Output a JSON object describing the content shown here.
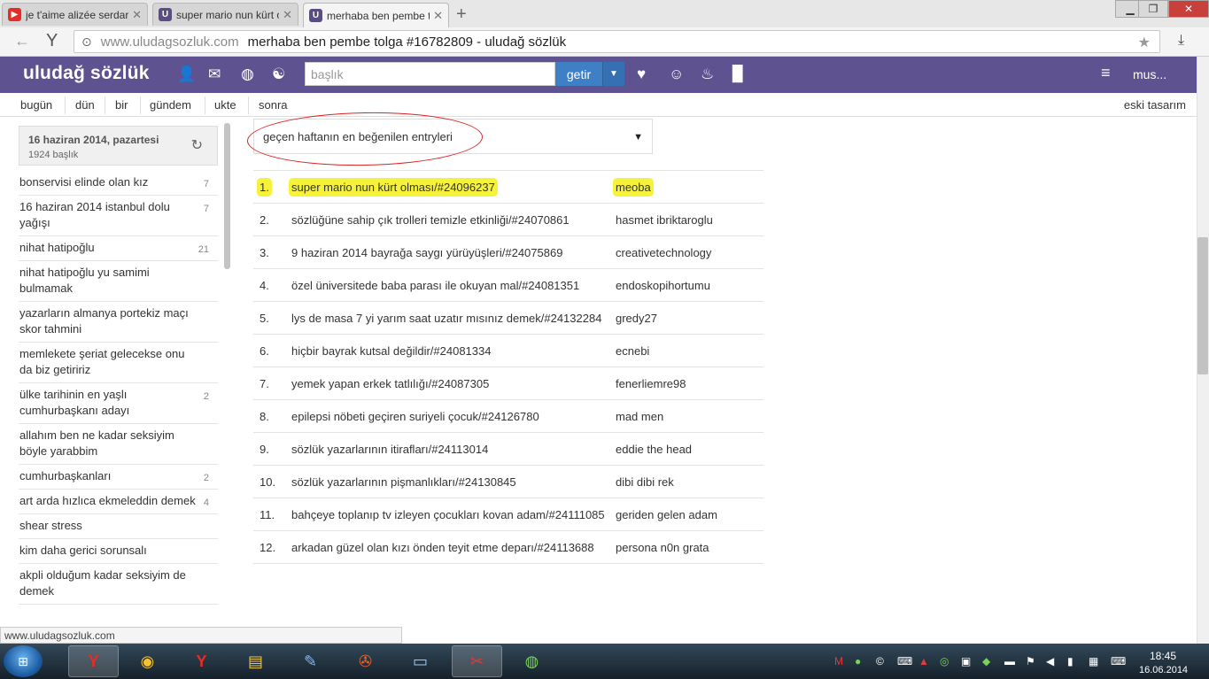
{
  "browser": {
    "tabs": [
      {
        "title": "je t'aime alizée serdar o",
        "favicon": "youtube-icon",
        "active": false
      },
      {
        "title": "super mario nun kürt o",
        "favicon": "uludag-icon",
        "active": false
      },
      {
        "title": "merhaba ben pembe t",
        "favicon": "uludag-icon",
        "active": true
      }
    ],
    "url_domain": "www.uludagsozluk.com",
    "url_title": "merhaba ben pembe tolga #16782809 - uludağ sözlük",
    "status_url": "www.uludagsozluk.com"
  },
  "header": {
    "logo": "uludağ sözlük",
    "search_placeholder": "başlık",
    "search_button": "getir",
    "user": "mus..."
  },
  "subnav": {
    "items": [
      "bugün",
      "dün",
      "bir",
      "gündem",
      "ukte",
      "sonra"
    ],
    "right": "eski tasarım"
  },
  "sidebar": {
    "date": "16 haziran 2014, pazartesi",
    "count": "1924 başlık",
    "topics": [
      {
        "title": "bonservisi elinde olan kız",
        "count": "7"
      },
      {
        "title": "16 haziran 2014 istanbul dolu yağışı",
        "count": "7"
      },
      {
        "title": "nihat hatipoğlu",
        "count": "21"
      },
      {
        "title": "nihat hatipoğlu yu samimi bulmamak",
        "count": ""
      },
      {
        "title": "yazarların almanya portekiz maçı skor tahmini",
        "count": ""
      },
      {
        "title": "memlekete şeriat gelecekse onu da biz getiririz",
        "count": ""
      },
      {
        "title": "ülke tarihinin en yaşlı cumhurbaşkanı adayı",
        "count": "2"
      },
      {
        "title": "allahım ben ne kadar seksiyim böyle yarabbim",
        "count": ""
      },
      {
        "title": "cumhurbaşkanları",
        "count": "2"
      },
      {
        "title": "art arda hızlıca ekmeleddin demek",
        "count": "4"
      },
      {
        "title": "shear stress",
        "count": ""
      },
      {
        "title": "kim daha gerici sorunsalı",
        "count": ""
      },
      {
        "title": "akpli olduğum kadar seksiyim de demek",
        "count": ""
      }
    ]
  },
  "main": {
    "filter": "geçen haftanın en beğenilen entryleri",
    "entries": [
      {
        "num": "1.",
        "title": "super mario nun kürt olması/#24096237",
        "author": "meoba",
        "highlight": true
      },
      {
        "num": "2.",
        "title": "sözlüğüne sahip çık trolleri temizle etkinliği/#24070861",
        "author": "hasmet ibriktaroglu"
      },
      {
        "num": "3.",
        "title": "9 haziran 2014 bayrağa saygı yürüyüşleri/#24075869",
        "author": "creativetechnology"
      },
      {
        "num": "4.",
        "title": "özel üniversitede baba parası ile okuyan mal/#24081351",
        "author": "endoskopihortumu"
      },
      {
        "num": "5.",
        "title": "lys de masa 7 yi yarım saat uzatır mısınız demek/#24132284",
        "author": "gredy27"
      },
      {
        "num": "6.",
        "title": "hiçbir bayrak kutsal değildir/#24081334",
        "author": "ecnebi"
      },
      {
        "num": "7.",
        "title": "yemek yapan erkek tatlılığı/#24087305",
        "author": "fenerliemre98"
      },
      {
        "num": "8.",
        "title": "epilepsi nöbeti geçiren suriyeli çocuk/#24126780",
        "author": "mad men"
      },
      {
        "num": "9.",
        "title": "sözlük yazarlarının itirafları/#24113014",
        "author": "eddie the head"
      },
      {
        "num": "10.",
        "title": "sözlük yazarlarının pişmanlıkları/#24130845",
        "author": "dibi dibi rek"
      },
      {
        "num": "11.",
        "title": "bahçeye toplanıp tv izleyen çocukları kovan adam/#24111085",
        "author": "geriden gelen adam"
      },
      {
        "num": "12.",
        "title": "arkadan güzel olan kızı önden teyit etme deparı/#24113688",
        "author": "persona n0n grata"
      }
    ]
  },
  "taskbar": {
    "time": "18:45",
    "date": "16.06.2014"
  },
  "colors": {
    "header_bg": "#5f5290",
    "search_button": "#3e7fc6",
    "highlight": "#f6f23a",
    "annotation": "#dd2222"
  }
}
